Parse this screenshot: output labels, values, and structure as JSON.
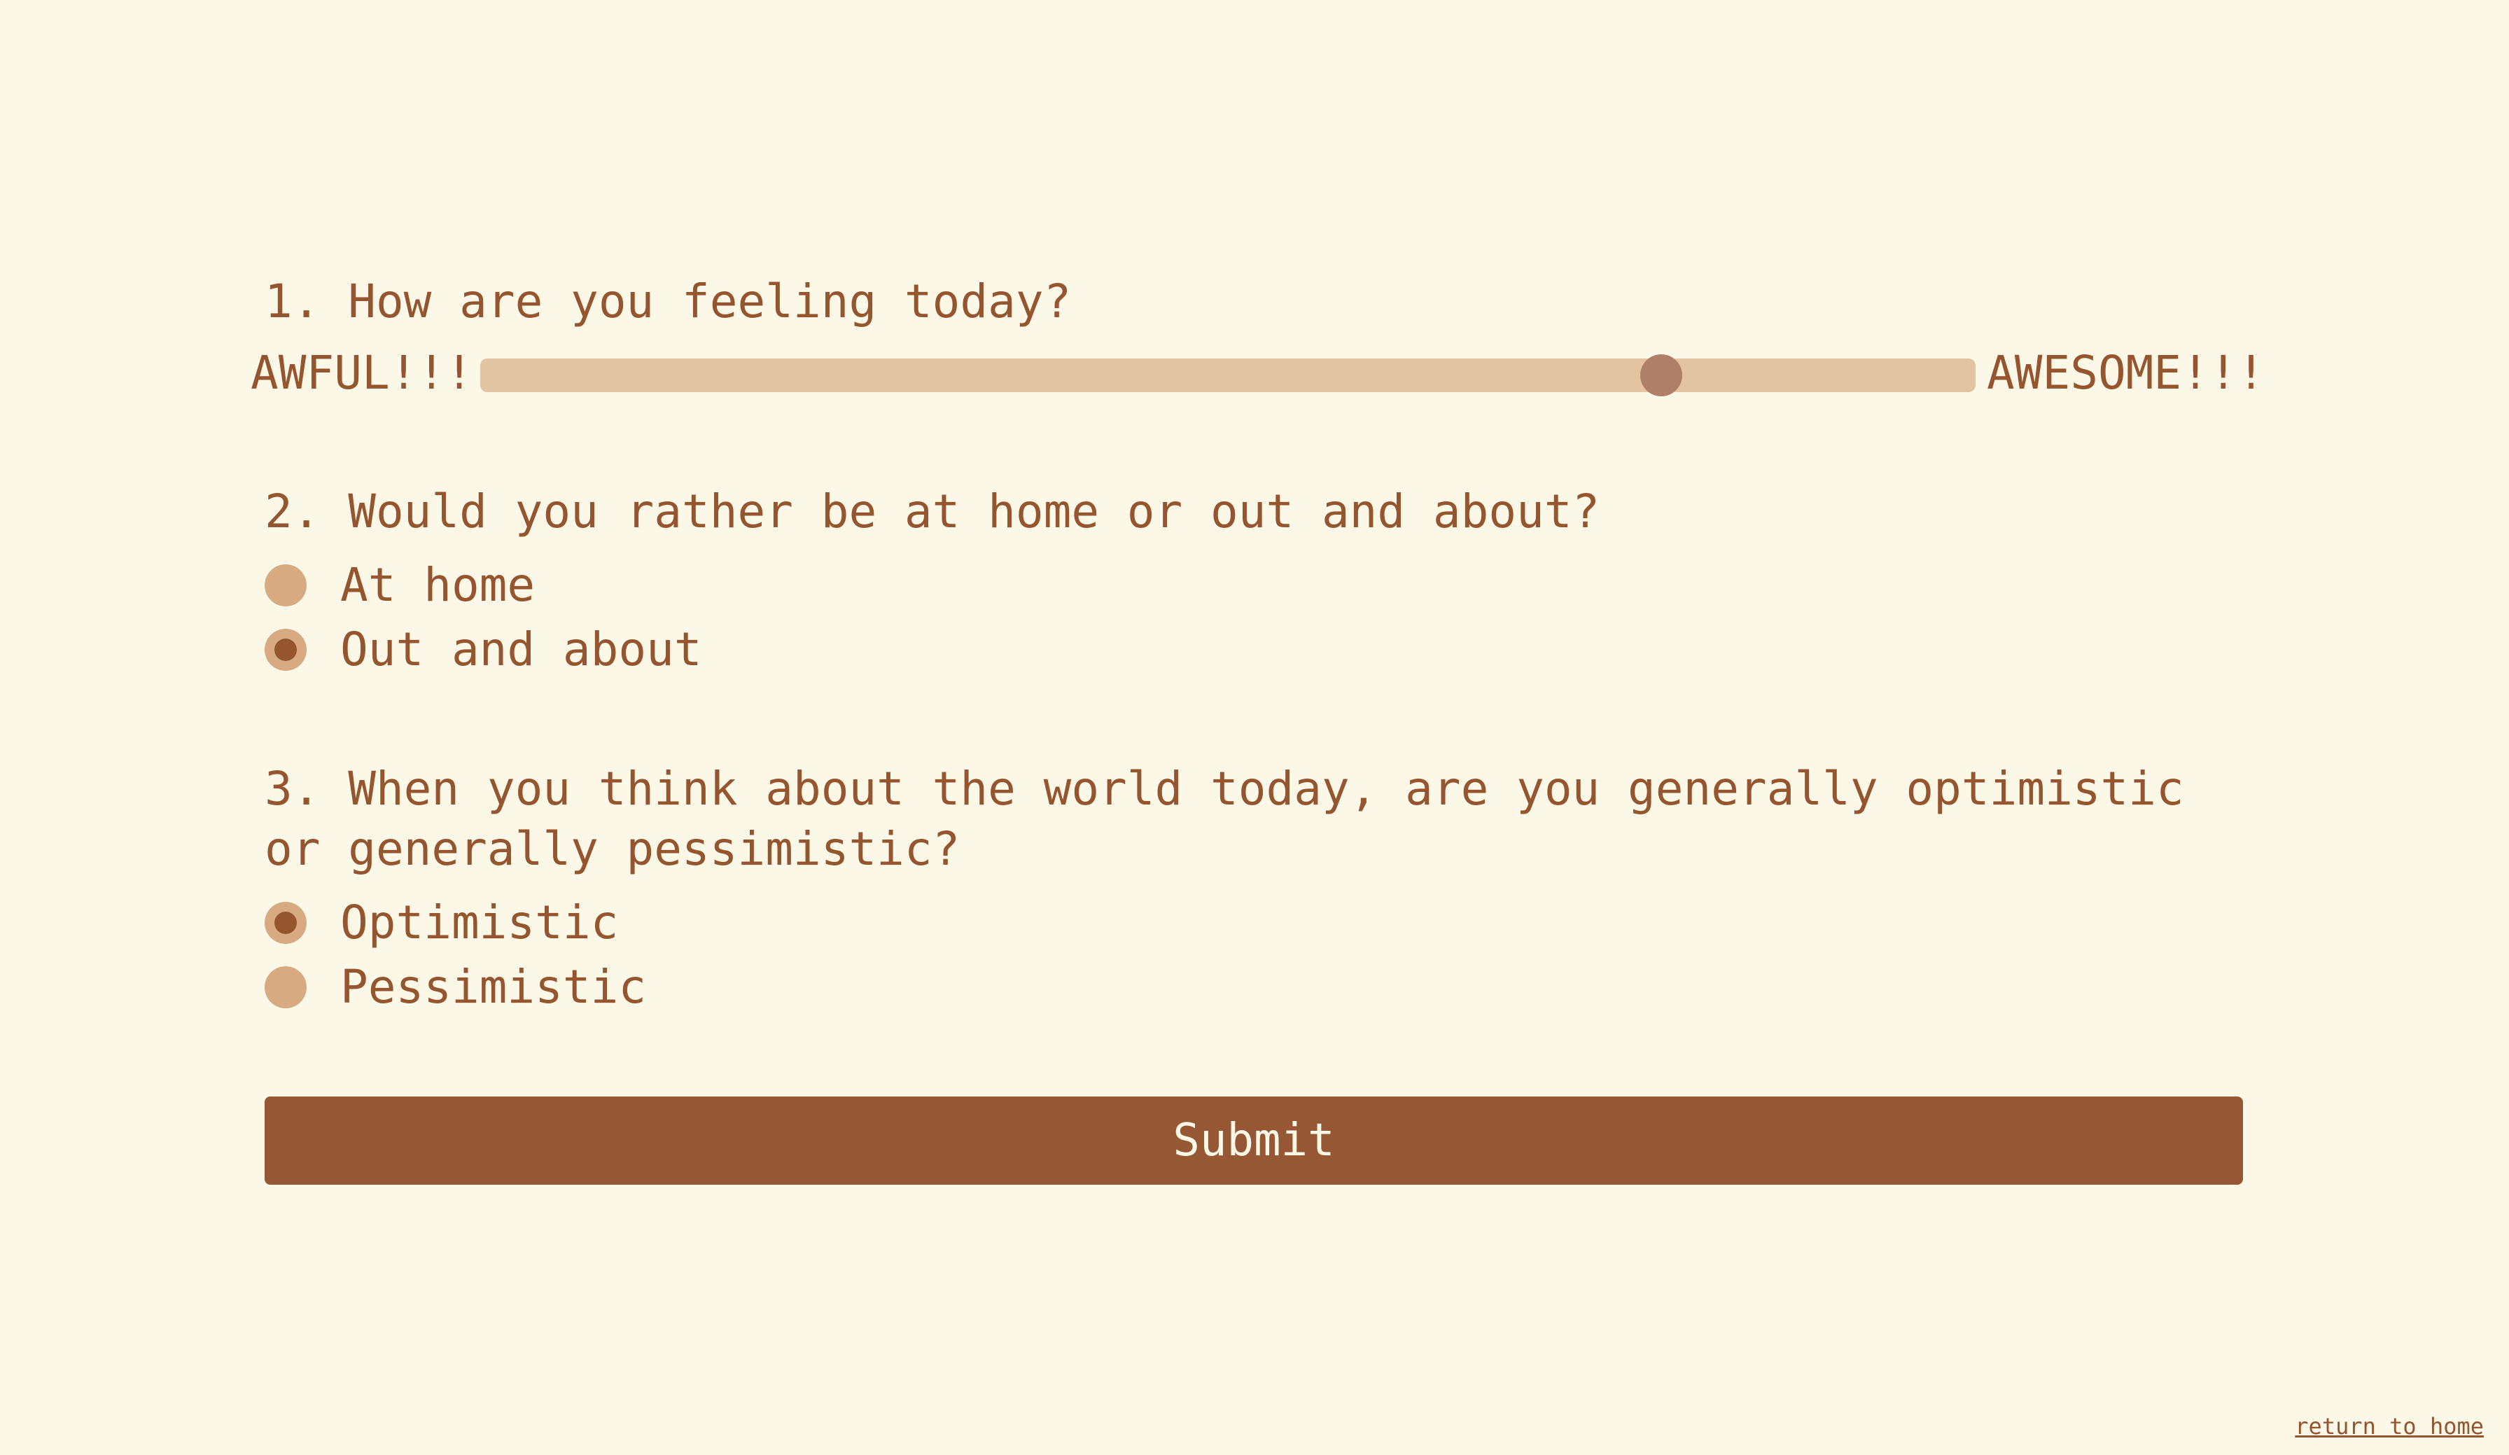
{
  "questions": [
    {
      "text": "1. How are you feeling today?",
      "min_label": "AWFUL!!!",
      "max_label": "AWESOME!!!",
      "slider_value": 0.79
    },
    {
      "text": "2. Would you rather be at home or out and about?",
      "options": [
        {
          "label": "At home",
          "selected": false
        },
        {
          "label": "Out and about",
          "selected": true
        }
      ]
    },
    {
      "text": "3. When you think about the world today, are you generally optimistic or generally pessimistic?",
      "options": [
        {
          "label": "Optimistic",
          "selected": true
        },
        {
          "label": "Pessimistic",
          "selected": false
        }
      ]
    }
  ],
  "submit_label": "Submit",
  "return_link": "return to home",
  "colors": {
    "background": "#fcf8e8",
    "text": "#94552f",
    "accent": "#965834",
    "track": "#e2c4a2",
    "thumb": "#b07f68",
    "radio": "#d8aa82"
  }
}
